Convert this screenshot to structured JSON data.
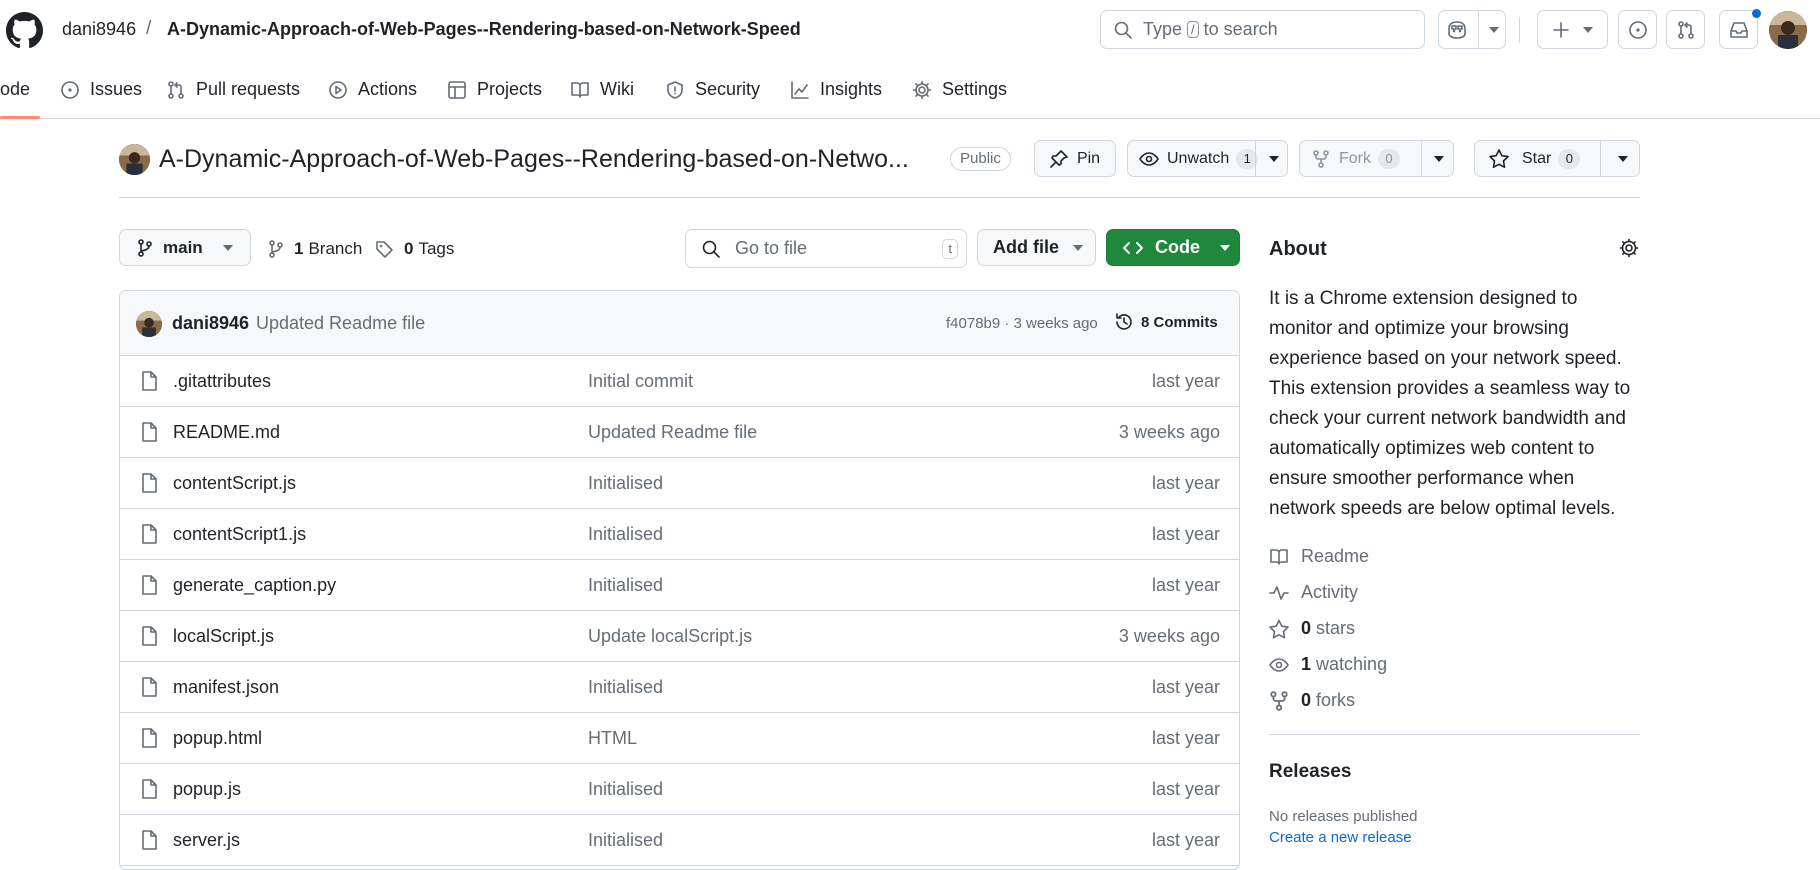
{
  "header": {
    "owner": "dani8946",
    "separator": "/",
    "repo": "A-Dynamic-Approach-of-Web-Pages--Rendering-based-on-Network-Speed",
    "search": {
      "prefix": "Type",
      "key": "/",
      "suffix": "to search"
    }
  },
  "nav": {
    "tabs": [
      {
        "label": "ode",
        "icon": "code-icon"
      },
      {
        "label": "Issues",
        "icon": "issue-icon"
      },
      {
        "label": "Pull requests",
        "icon": "pull-request-icon"
      },
      {
        "label": "Actions",
        "icon": "play-icon"
      },
      {
        "label": "Projects",
        "icon": "table-icon"
      },
      {
        "label": "Wiki",
        "icon": "book-icon"
      },
      {
        "label": "Security",
        "icon": "shield-icon"
      },
      {
        "label": "Insights",
        "icon": "graph-icon"
      },
      {
        "label": "Settings",
        "icon": "gear-icon"
      }
    ]
  },
  "repo_header": {
    "title": "A-Dynamic-Approach-of-Web-Pages--Rendering-based-on-Netwo...",
    "visibility": "Public",
    "pin": "Pin",
    "unwatch": "Unwatch",
    "watch_count": "1",
    "fork": "Fork",
    "fork_count": "0",
    "star": "Star",
    "star_count": "0"
  },
  "toolbar": {
    "branch": "main",
    "branches_count": "1",
    "branches_label": "Branch",
    "tags_count": "0",
    "tags_label": "Tags",
    "goto_placeholder": "Go to file",
    "goto_key": "t",
    "add_file": "Add file",
    "code": "Code"
  },
  "commit": {
    "author": "dani8946",
    "message": "Updated Readme file",
    "hash_time": "f4078b9 · 3 weeks ago",
    "commits": "8 Commits"
  },
  "files": [
    {
      "name": ".gitattributes",
      "message": "Initial commit",
      "date": "last year"
    },
    {
      "name": "README.md",
      "message": "Updated Readme file",
      "date": "3 weeks ago"
    },
    {
      "name": "contentScript.js",
      "message": "Initialised",
      "date": "last year"
    },
    {
      "name": "contentScript1.js",
      "message": "Initialised",
      "date": "last year"
    },
    {
      "name": "generate_caption.py",
      "message": "Initialised",
      "date": "last year"
    },
    {
      "name": "localScript.js",
      "message": "Update localScript.js",
      "date": "3 weeks ago"
    },
    {
      "name": "manifest.json",
      "message": "Initialised",
      "date": "last year"
    },
    {
      "name": "popup.html",
      "message": "HTML",
      "date": "last year"
    },
    {
      "name": "popup.js",
      "message": "Initialised",
      "date": "last year"
    },
    {
      "name": "server.js",
      "message": "Initialised",
      "date": "last year"
    }
  ],
  "about": {
    "title": "About",
    "description": "It is a Chrome extension designed to monitor and optimize your browsing experience based on your network speed. This extension provides a seamless way to check your current network bandwidth and automatically optimizes web content to ensure smoother performance when network speeds are below optimal levels.",
    "readme": "Readme",
    "activity": "Activity",
    "stars_count": "0",
    "stars_label": "stars",
    "watching_count": "1",
    "watching_label": "watching",
    "forks_count": "0",
    "forks_label": "forks"
  },
  "releases": {
    "title": "Releases",
    "none": "No releases published",
    "create": "Create a new release"
  },
  "colors": {
    "primary_green": "#1f883d",
    "link_blue": "#0969da",
    "active_tab": "#fd8c73",
    "notification_dot": "#0969da"
  }
}
